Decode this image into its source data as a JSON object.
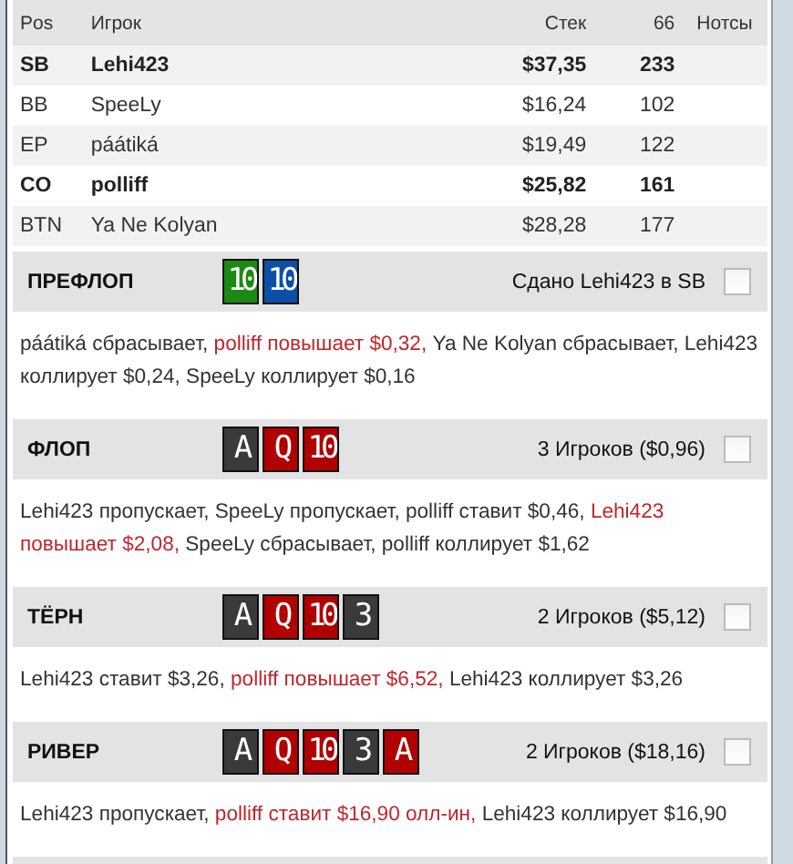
{
  "table": {
    "columns": [
      "Pos",
      "Игрок",
      "Стек",
      "66",
      "Нотсы"
    ],
    "rows": [
      {
        "pos": "SB",
        "player": "Lehi423",
        "stack": "$37,35",
        "hands": "233",
        "highlighted": true
      },
      {
        "pos": "BB",
        "player": "SpeeLy",
        "stack": "$16,24",
        "hands": "102",
        "highlighted": false
      },
      {
        "pos": "EP",
        "player": "páátiká",
        "stack": "$19,49",
        "hands": "122",
        "highlighted": false
      },
      {
        "pos": "CO",
        "player": "polliff",
        "stack": "$25,82",
        "hands": "161",
        "highlighted": true
      },
      {
        "pos": "BTN",
        "player": "Ya Ne Kolyan",
        "stack": "$28,28",
        "hands": "177",
        "highlighted": false
      }
    ]
  },
  "streets": [
    {
      "name": "ПРЕФЛОП",
      "cards": [
        {
          "rank": "10",
          "color": "#1a8a12"
        },
        {
          "rank": "10",
          "color": "#0c4fa8"
        }
      ],
      "info": "Сдано Lehi423 в SB",
      "checked": false,
      "actions": [
        {
          "text": "páátiká сбрасывает, ",
          "aggressive": false
        },
        {
          "text": "polliff повышает $0,32,",
          "aggressive": true
        },
        {
          "text": " Ya Ne Kolyan сбрасывает, Lehi423 коллирует $0,24, SpeeLy коллирует $0,16",
          "aggressive": false
        }
      ]
    },
    {
      "name": "ФЛОП",
      "cards": [
        {
          "rank": "A",
          "color": "#3a3a3a"
        },
        {
          "rank": "Q",
          "color": "#b00000"
        },
        {
          "rank": "10",
          "color": "#b00000"
        }
      ],
      "info": "3 Игроков ($0,96)",
      "checked": false,
      "actions": [
        {
          "text": "Lehi423 пропускает, SpeeLy пропускает, polliff ставит $0,46, ",
          "aggressive": false
        },
        {
          "text": "Lehi423 повышает $2,08,",
          "aggressive": true
        },
        {
          "text": " SpeeLy сбрасывает, polliff коллирует $1,62",
          "aggressive": false
        }
      ]
    },
    {
      "name": "ТЁРН",
      "cards": [
        {
          "rank": "A",
          "color": "#3a3a3a"
        },
        {
          "rank": "Q",
          "color": "#b00000"
        },
        {
          "rank": "10",
          "color": "#b00000"
        },
        {
          "rank": "3",
          "color": "#3a3a3a"
        }
      ],
      "info": "2 Игроков ($5,12)",
      "checked": false,
      "actions": [
        {
          "text": "Lehi423 ставит $3,26, ",
          "aggressive": false
        },
        {
          "text": "polliff повышает $6,52,",
          "aggressive": true
        },
        {
          "text": " Lehi423 коллирует $3,26",
          "aggressive": false
        }
      ]
    },
    {
      "name": "РИВЕР",
      "cards": [
        {
          "rank": "A",
          "color": "#3a3a3a"
        },
        {
          "rank": "Q",
          "color": "#b00000"
        },
        {
          "rank": "10",
          "color": "#b00000"
        },
        {
          "rank": "3",
          "color": "#3a3a3a"
        },
        {
          "rank": "A",
          "color": "#b00000"
        }
      ],
      "info": "2 Игроков ($18,16)",
      "checked": false,
      "actions": [
        {
          "text": "Lehi423 пропускает, ",
          "aggressive": false
        },
        {
          "text": "polliff ставит $16,90 олл-ин,",
          "aggressive": true
        },
        {
          "text": " Lehi423 коллирует $16,90",
          "aggressive": false
        }
      ]
    }
  ]
}
